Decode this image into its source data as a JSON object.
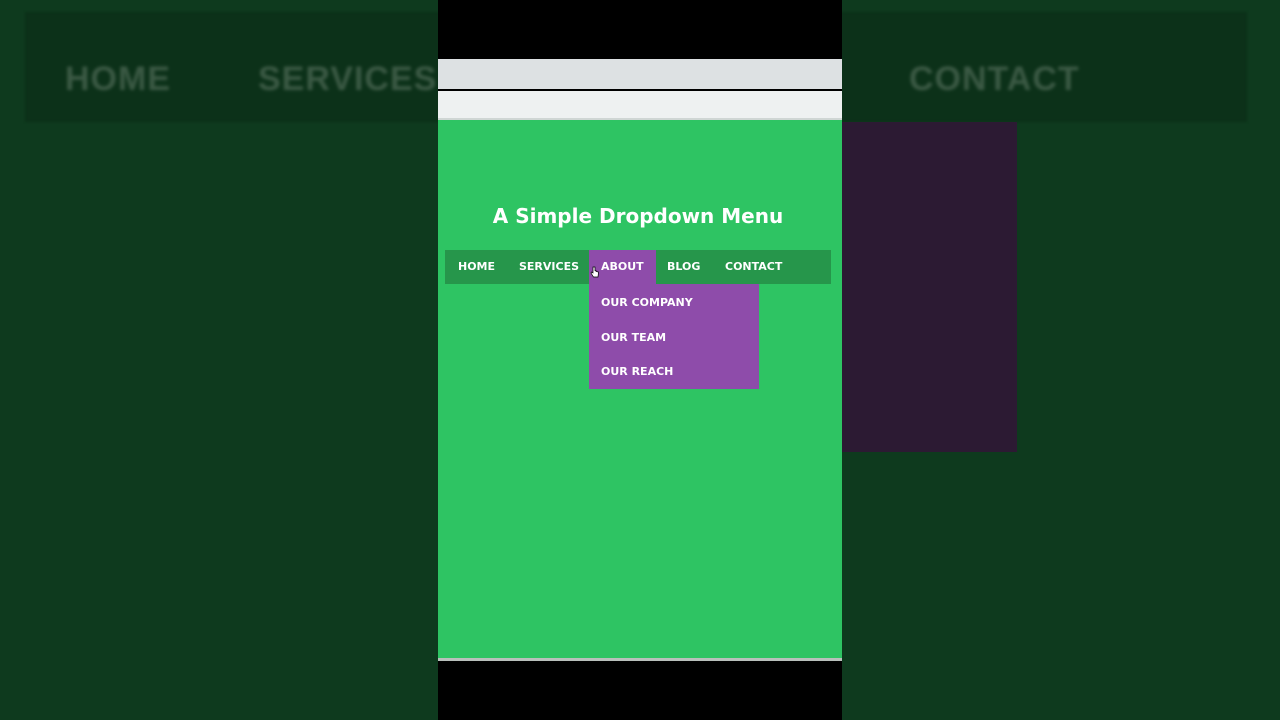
{
  "backdrop": {
    "nav_items": [
      "HOME",
      "SERVICES",
      "CONTACT"
    ]
  },
  "page": {
    "title": "A Simple Dropdown Menu",
    "nav": {
      "items": [
        {
          "label": "HOME"
        },
        {
          "label": "SERVICES"
        },
        {
          "label": "ABOUT"
        },
        {
          "label": "BLOG"
        },
        {
          "label": "CONTACT"
        }
      ],
      "active": "ABOUT"
    },
    "dropdown": {
      "items": [
        "OUR COMPANY",
        "OUR TEAM",
        "OUR REACH"
      ]
    }
  },
  "colors": {
    "page_bg": "#2ec463",
    "nav_bg": "#26964b",
    "active_bg": "#8e4caa",
    "text": "#ffffff"
  },
  "icons": {
    "cursor": "hand-pointer-icon"
  }
}
